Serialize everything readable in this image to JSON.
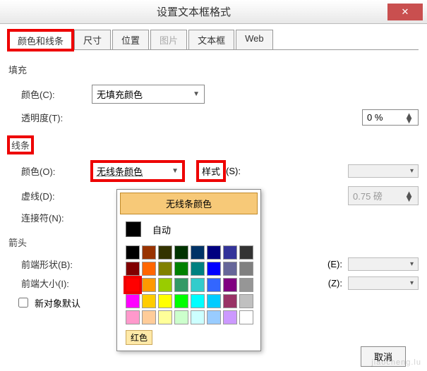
{
  "window": {
    "title": "设置文本框格式",
    "close": "✕"
  },
  "tabs": {
    "color_lines": "颜色和线条",
    "size": "尺寸",
    "position": "位置",
    "picture": "图片",
    "textbox": "文本框",
    "web": "Web"
  },
  "fill": {
    "section": "填充",
    "color_label": "颜色(C):",
    "color_value": "无填充颜色",
    "transparency_label": "透明度(T):",
    "transparency_value": "0 %"
  },
  "line": {
    "section": "线条",
    "color_label": "颜色(O):",
    "color_value": "无线条颜色",
    "style_label": "样式",
    "style_suffix": "(S):",
    "dash_label": "虚线(D):",
    "weight_value": "0.75 磅",
    "connector_label": "连接符(N):"
  },
  "arrows": {
    "section": "箭头",
    "begin_shape": "前端形状(B):",
    "end_shape_suffix": "(E):",
    "begin_size": "前端大小(I):",
    "end_size_suffix": "(Z):"
  },
  "misc": {
    "new_default": "新对象默认",
    "cancel": "取消"
  },
  "color_popup": {
    "header": "无线条颜色",
    "auto": "自动",
    "selected_name": "红色",
    "rows": [
      [
        "#000000",
        "#993300",
        "#333300",
        "#003300",
        "#003366",
        "#000080",
        "#333399",
        "#333333"
      ],
      [
        "#800000",
        "#ff6600",
        "#808000",
        "#008000",
        "#008080",
        "#0000ff",
        "#666699",
        "#808080"
      ],
      [
        "#ff0000",
        "#ff9900",
        "#99cc00",
        "#339966",
        "#33cccc",
        "#3366ff",
        "#800080",
        "#969696"
      ],
      [
        "#ff00ff",
        "#ffcc00",
        "#ffff00",
        "#00ff00",
        "#00ffff",
        "#00ccff",
        "#993366",
        "#c0c0c0"
      ],
      [
        "#ff99cc",
        "#ffcc99",
        "#ffff99",
        "#ccffcc",
        "#ccffff",
        "#99ccff",
        "#cc99ff",
        "#ffffff"
      ]
    ],
    "selected": [
      2,
      0
    ]
  },
  "watermark": "jiaocheng.lu"
}
